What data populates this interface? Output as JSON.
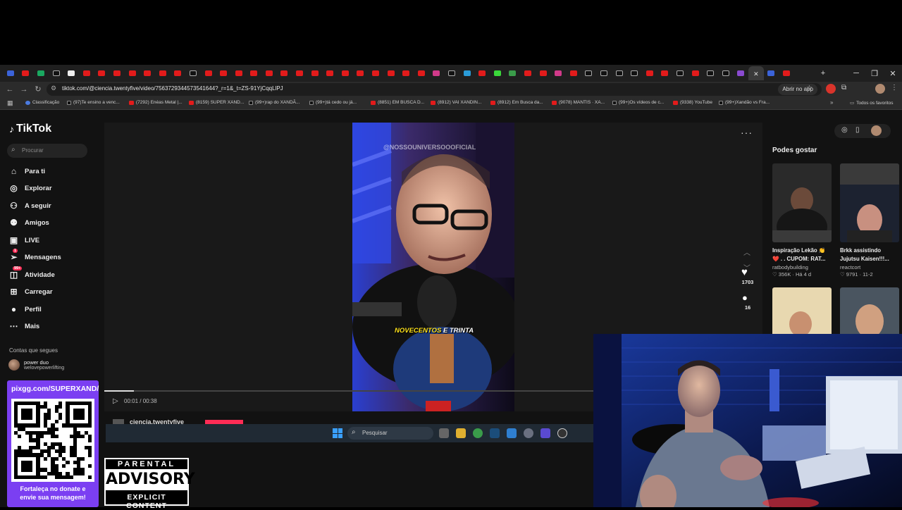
{
  "browser": {
    "tab_count": 52,
    "url": "tiktok.com/@ciencia.twentyfive/video/7563729344573541644?_r=1&_t=ZS-91YjCqqLlPJ",
    "open_in_app_label": "Abrir no app",
    "all_favorites_label": "Todos os favoritos",
    "bookmarks": [
      {
        "label": "Classificação",
        "kind": "g"
      },
      {
        "label": "(97)Te ensino a venc...",
        "kind": "tk"
      },
      {
        "label": "(7292) Enéas Metal |...",
        "kind": "yt"
      },
      {
        "label": "(8159) SUPER XAND...",
        "kind": "yt"
      },
      {
        "label": "(99+)rap do XANDÃ...",
        "kind": "tk"
      },
      {
        "label": "(99+)tá cedo ou já...",
        "kind": "tk"
      },
      {
        "label": "(8851) EM BUSCA D...",
        "kind": "yt"
      },
      {
        "label": "(8912) VAI XANDIN...",
        "kind": "yt"
      },
      {
        "label": "(8912) Em Busca da...",
        "kind": "yt"
      },
      {
        "label": "(9078) MANTIS · XA...",
        "kind": "yt"
      },
      {
        "label": "(99+)Os vídeos de c...",
        "kind": "tk"
      },
      {
        "label": "(9338) YouTube",
        "kind": "yt"
      },
      {
        "label": "(99+)Xandão vs Fra...",
        "kind": "tk"
      }
    ]
  },
  "tiktok": {
    "logo": "TikTok",
    "search_placeholder": "Procurar",
    "nav": [
      {
        "label": "Para ti",
        "icon": "home-icon",
        "glyph": "⌂"
      },
      {
        "label": "Explorar",
        "icon": "compass-icon",
        "glyph": "◎"
      },
      {
        "label": "A seguir",
        "icon": "following-icon",
        "glyph": "⚇"
      },
      {
        "label": "Amigos",
        "icon": "friends-icon",
        "glyph": "⚉"
      },
      {
        "label": "LIVE",
        "icon": "live-icon",
        "glyph": "▣"
      },
      {
        "label": "Mensagens",
        "icon": "messages-icon",
        "glyph": "➢"
      },
      {
        "label": "Atividade",
        "icon": "activity-icon",
        "glyph": "◫"
      },
      {
        "label": "Carregar",
        "icon": "upload-icon",
        "glyph": "⊞"
      },
      {
        "label": "Perfil",
        "icon": "profile-icon",
        "glyph": "●"
      },
      {
        "label": "Mais",
        "icon": "more-icon",
        "glyph": "⋯"
      }
    ],
    "messages_badge": "1",
    "activity_badge": "99+",
    "follows_title": "Contas que segues",
    "follow_account": {
      "name": "power duo",
      "handle": "welovepowerlifting"
    },
    "video": {
      "watermark": "@NOSSOUNIVERSOOOFICIAL",
      "caption_part1": "NOVECENTOS",
      "caption_part2": "E TRINTA",
      "time": "00:01 / 00:38",
      "progress": 0.06,
      "likes": "1703",
      "comments": "16",
      "author": "ciencia.twentyfive"
    },
    "suggestions_title": "Podes gostar",
    "suggestions": [
      {
        "title": "Inspiração Lekão 👏",
        "title2": "❤️ . . CUPOM: RAT...",
        "user": "ratbodybuilding",
        "stats": "♡ 356K · Há 4 d"
      },
      {
        "title": "Brkk assistindo",
        "title2": "Jujutsu Kaisen!!!...",
        "user": "reactcort",
        "stats": "♡ 9791 · 11-2"
      }
    ]
  },
  "taskbar": {
    "search_label": "Pesquisar"
  },
  "overlay": {
    "pix_url": "pixgg.com/SUPERXAND/",
    "pix_text_line1": "Fortaleça no donate e",
    "pix_text_line2": "envie sua mensagem!",
    "advisory_line1": "PARENTAL",
    "advisory_line2": "ADVISORY",
    "advisory_line3": "EXPLICIT CONTENT"
  },
  "colors": {
    "tiktok_red": "#fe2c55",
    "youtube_red": "#e21b1b",
    "pix_purple": "#7b3ff2"
  }
}
